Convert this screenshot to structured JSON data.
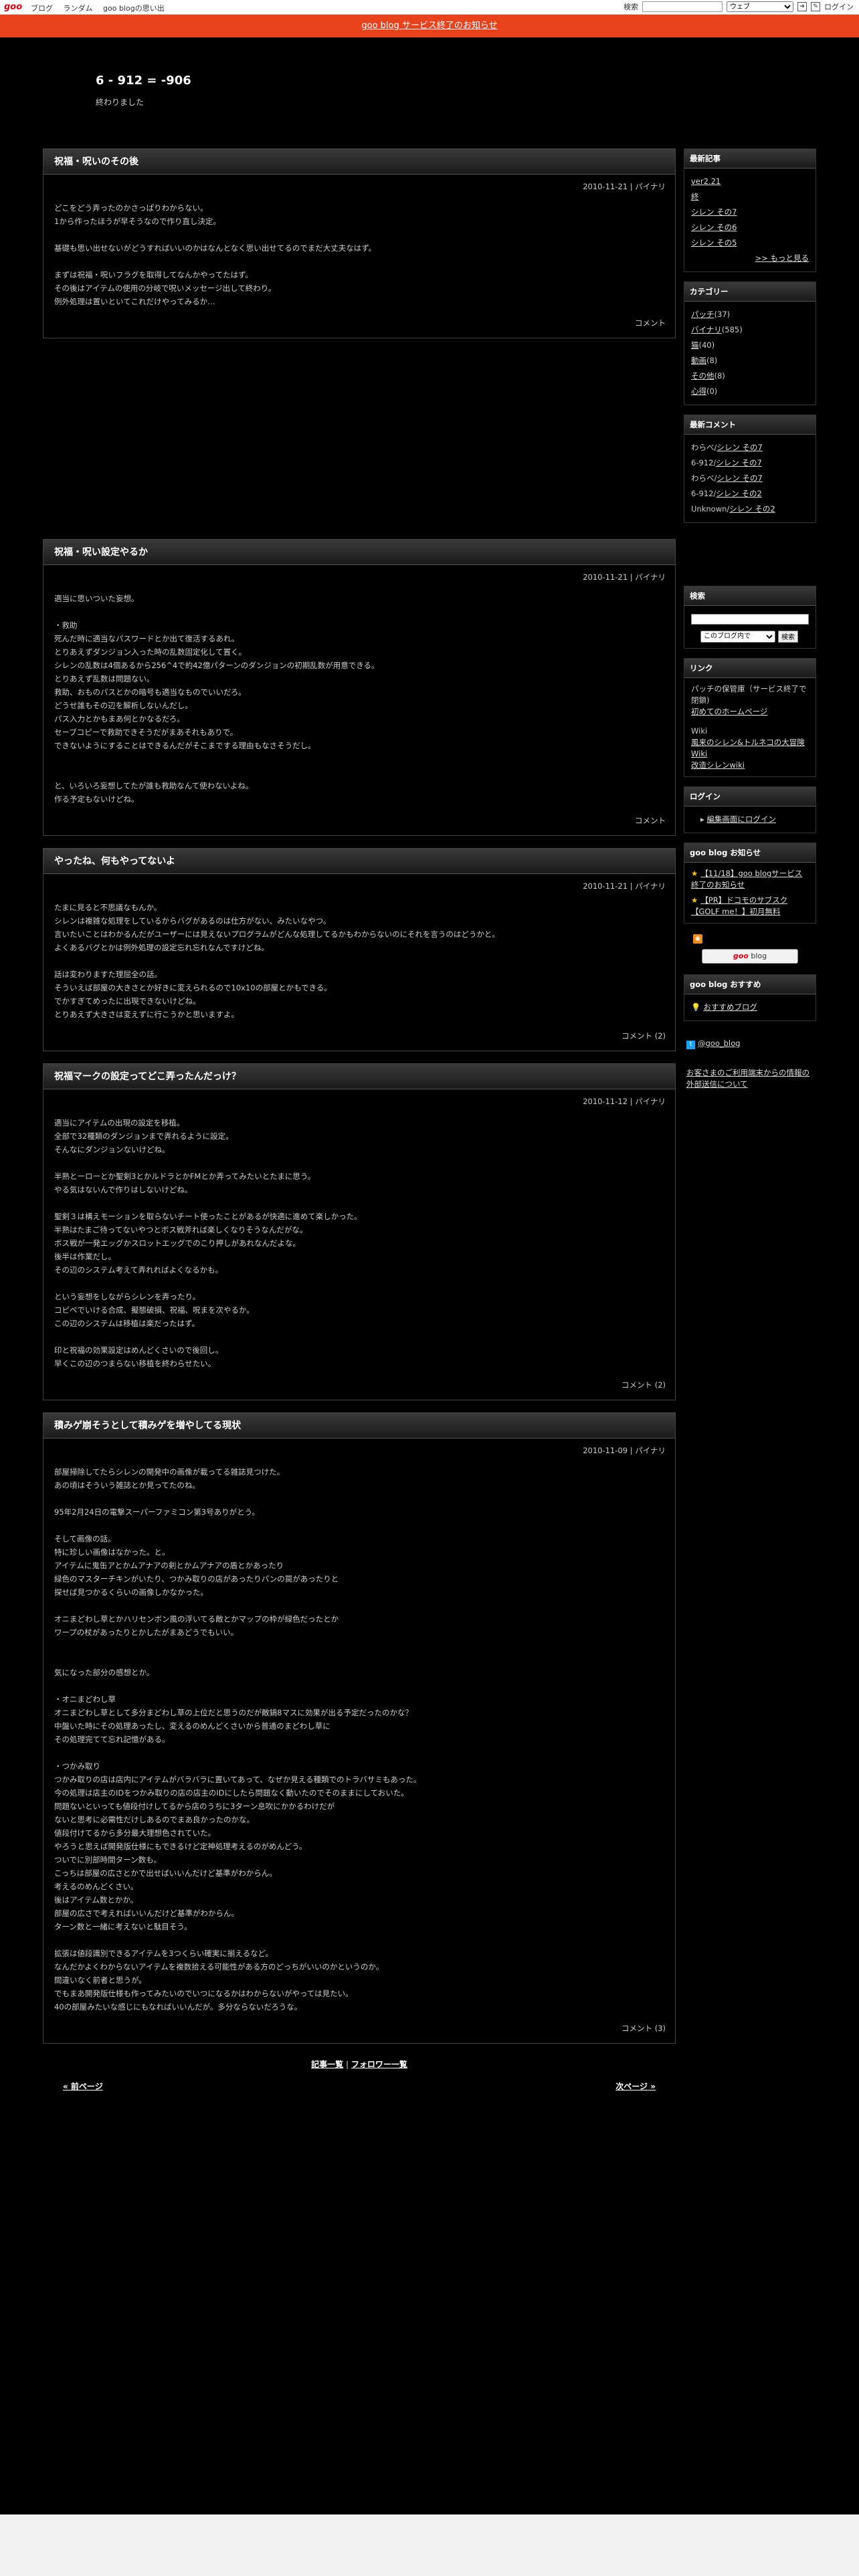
{
  "topbar": {
    "logo": "goo",
    "nav": [
      "ブログ",
      "ランダム",
      "goo blogの思い出"
    ],
    "search_label": "検索",
    "search_scope": "ウェブ",
    "login": "ログイン"
  },
  "notice": "goo blog サービス終了のお知らせ",
  "blog": {
    "title": "6 - 912 = -906",
    "description": "終わりました"
  },
  "entries": [
    {
      "title": "祝福・呪いのその後",
      "meta": "2010-11-21 | パイナリ",
      "body": "どこをどう弄ったのかさっぱりわからない。\n1から作ったほうが早そうなので作り直し決定。\n\n基礎も思い出せないがどうすればいいのかはなんとなく思い出せてるのでまだ大丈夫なはず。\n\nまずは祝福・呪いフラグを取得してなんかやってたはず。\nその後はアイテムの使用の分岐で呪いメッセージ出して終わり。\n例外処理は置いといてこれだけやってみるか…",
      "footer": "コメント"
    },
    {
      "title": "祝福・呪い設定やるか",
      "meta": "2010-11-21 | パイナリ",
      "body": "適当に思いついた妄想。\n\n・救助\n死んだ時に適当なパスワードとか出て復活するあれ。\nとりあえずダンジョン入った時の乱数固定化して置く。\nシレンの乱数は4個あるから256^4で約42億パターンのダンジョンの初期乱数が用意できる。\nとりあえず乱数は問題ない。\n救助、おものパスとかの暗号も適当なものでいいだろ。\nどうせ誰もその辺を解析しないんだし。\nパス入力とかもまあ何とかなるだろ。\nセーブコピーで救助できそうだがまあそれもありで。\nできないようにすることはできるんだがそこまでする理由もなさそうだし。\n\n\nと、いろいろ妄想してたが誰も救助なんて使わないよね。\n作る予定もないけどね。",
      "footer": "コメント"
    },
    {
      "title": "やったね、何もやってないよ",
      "meta": "2010-11-21 | パイナリ",
      "body": "たまに見ると不思議なもんか。\nシレンは複雑な処理をしているからバグがあるのは仕方がない、みたいなやつ。\n言いたいことはわかるんだがユーザーには見えないプログラムがどんな処理してるかもわからないのにそれを言うのはどうかと。\nよくあるバグとかは例外処理の設定忘れ忘れなんですけどね。\n\n話は変わりますた理屈全の話。\nそういえば部屋の大きさとか好きに変えられるので10x10の部屋とかもできる。\nでかすぎてめったに出現できないけどね。\nとりあえず大きさは変えずに行こうかと思いますよ。",
      "footer": "コメント (2)"
    },
    {
      "title": "祝福マークの設定ってどこ弄ったんだっけ？",
      "meta": "2010-11-12 | パイナリ",
      "body": "適当にアイテムの出現の設定を移植。\n全部で32種類のダンジョンまで弄れるように設定。\nそんなにダンジョンないけどね。\n\n半熟とーローとか聖剣3とかルドラとかFMとか弄ってみたいとたまに思う。\nやる気はないんで作りはしないけどね。\n\n聖剣３は構えモーションを取らないチート使ったことがあるが快適に進めて楽しかった。\n半熟はたまご待ってないやつとボス戦斧れば楽しくなりそうなんだがな。\nボス戦が一発エッグかスロットエッグでのこり押しがあれなんだよな。\n後半は作業だし。\nその辺のシステム考えて弄れればよくなるかも。\n\nという妄想をしながらシレンを弄ったり。\nコピペでいける合成、擬態破損、祝福、呪まを次やるか。\nこの辺のシステムは移植は楽だったはず。\n\n印と祝福の効果設定はめんどくさいので後回し。\n早くこの辺のつまらない移植を終わらせたい。",
      "footer": "コメント (2)"
    },
    {
      "title": "積みゲ崩そうとして積みゲを増やしてる現状",
      "meta": "2010-11-09 | パイナリ",
      "body": "部屋掃除してたらシレンの開発中の画像が載ってる雑誌見つけた。\nあの頃はそういう雑誌とか見ってたのね。\n\n95年2月24日の電撃スーパーファミコン第3号ありがとう。\n\nそして画像の話。\n特に珍しい画像はなかった。と。\nアイテムに鬼缶アとかムアナアの剣とかムアナアの盾とかあったり\n緑色のマスターチキンがいたり、つかみ取りの店があったりパンの罠があったりと\n探せば見つかるくらいの画像しかなかった。\n\nオニまどわし草とかハリセンボン風の浮いてる敵とかマップの枠が緑色だったとか\nワープの杖があったりとかしたがまあどうでもいい。\n\n\n気になった部分の感想とか。\n\n・オニまどわし草\nオニまどわし草として多分まどわし草の上位だと思うのだが敵鍋8マスに効果が出る予定だったのかな？\n中盤いた時にその処理あったし、変えるのめんどくさいから普通のまどわし草に\nその処理完てて忘れ記憶がある。\n\n・つかみ取り\nつかみ取りの店は店内にアイテムがバラバラに置いてあって、なぜか見える種類でのトラバサミもあった。\n今の処理は店主のIDをつかみ取りの店の店主のIDにしたら問題なく動いたのでそのままにしておいた。\n問題ないといっても値段付けしてるから店のうちに3ターン息吹にかかるわけだが\nないと思考に必需性だけしあるのでまあ良かったのかな。\n値段付けてるから多分最大理想色されていた。\nやろうと思えば開発版仕様にもできるけど定神処理考えるのがめんどう。\nついでに別部時間ターン数も。\nこっちは部屋の広さとかで出せばいいんだけど基準がわからん。\n考えるのめんどくさい。\n後はアイテム数とかか。\n部屋の広さで考えればいいんだけど基準がわからん。\nターン数と一緒に考えないと駄目そう。\n\n拡張は値段識別できるアイテムを3つくらい確実に揃えるなど。\nなんだかよくわからないアイテムを複数拾える可能性がある方のどっちがいいのかというのか。\n間違いなく前者と思うが。\nでもまあ開発版仕様も作ってみたいのでいつになるかはわからないがやっては見たい。\n40の部屋みたいな感じにもなればいいんだが。多分ならないだろうな。",
      "footer": "コメント (3)"
    }
  ],
  "pager": {
    "article_list": "記事一覧",
    "separator": "|",
    "follower_list": "フォロワー一覧",
    "prev": "« 前ページ",
    "next": "次ページ »"
  },
  "sidebar": {
    "recent": {
      "heading": "最新記事",
      "items": [
        "ver2.21",
        "終",
        "シレン その7",
        "シレン その6",
        "シレン その5"
      ],
      "more": ">> もっと見る"
    },
    "categories": {
      "heading": "カテゴリー",
      "items": [
        {
          "name": "パッチ",
          "count": "(37)"
        },
        {
          "name": "バイナリ",
          "count": "(585)"
        },
        {
          "name": "猫",
          "count": "(40)"
        },
        {
          "name": "動画",
          "count": "(8)"
        },
        {
          "name": "その他",
          "count": "(8)"
        },
        {
          "name": "心得",
          "count": "(0)"
        }
      ]
    },
    "comments": {
      "heading": "最新コメント",
      "items": [
        {
          "who": "わらべ",
          "sep": "/",
          "link": "シレン その7"
        },
        {
          "who": "6-912",
          "sep": "/",
          "link": "シレン その7"
        },
        {
          "who": "わらべ",
          "sep": "/",
          "link": "シレン その7"
        },
        {
          "who": "6-912",
          "sep": "/",
          "link": "シレン その2"
        },
        {
          "who": "Unknown",
          "sep": "/",
          "link": "シレン その2"
        }
      ]
    },
    "search": {
      "heading": "検索",
      "scope": "このブログ内で",
      "button": "検索"
    },
    "links": {
      "heading": "リンク",
      "items": [
        {
          "text": "パッチの保管庫（サービス終了で閉鎖)",
          "link": false
        },
        {
          "text": "初めてのホームページ",
          "link": true
        },
        {
          "text": "",
          "link": false
        },
        {
          "text": "Wiki",
          "link": false
        },
        {
          "text": "風来のシレン&トルネコの大冒険 Wiki",
          "link": true
        },
        {
          "text": "改造シレンwiki",
          "link": true
        }
      ]
    },
    "login": {
      "heading": "ログイン",
      "link": "編集画面にログイン"
    },
    "goo_notice": {
      "heading": "goo blog お知らせ",
      "items": [
        "【11/18】goo blogサービス終了のお知らせ",
        "【PR】ドコモのサブスク【GOLF me！】初月無料"
      ]
    },
    "goo_button": {
      "brand": "goo",
      "text": "blog"
    },
    "recommend": {
      "heading": "goo blog おすすめ",
      "item": "おすすめブログ"
    },
    "twitter": "@goo_blog",
    "external": "お客さまのご利用端末からの情報の外部送信について"
  },
  "colors": {
    "background": "#000000",
    "notice_band": "#e8421c",
    "logo_red": "#e60012"
  }
}
